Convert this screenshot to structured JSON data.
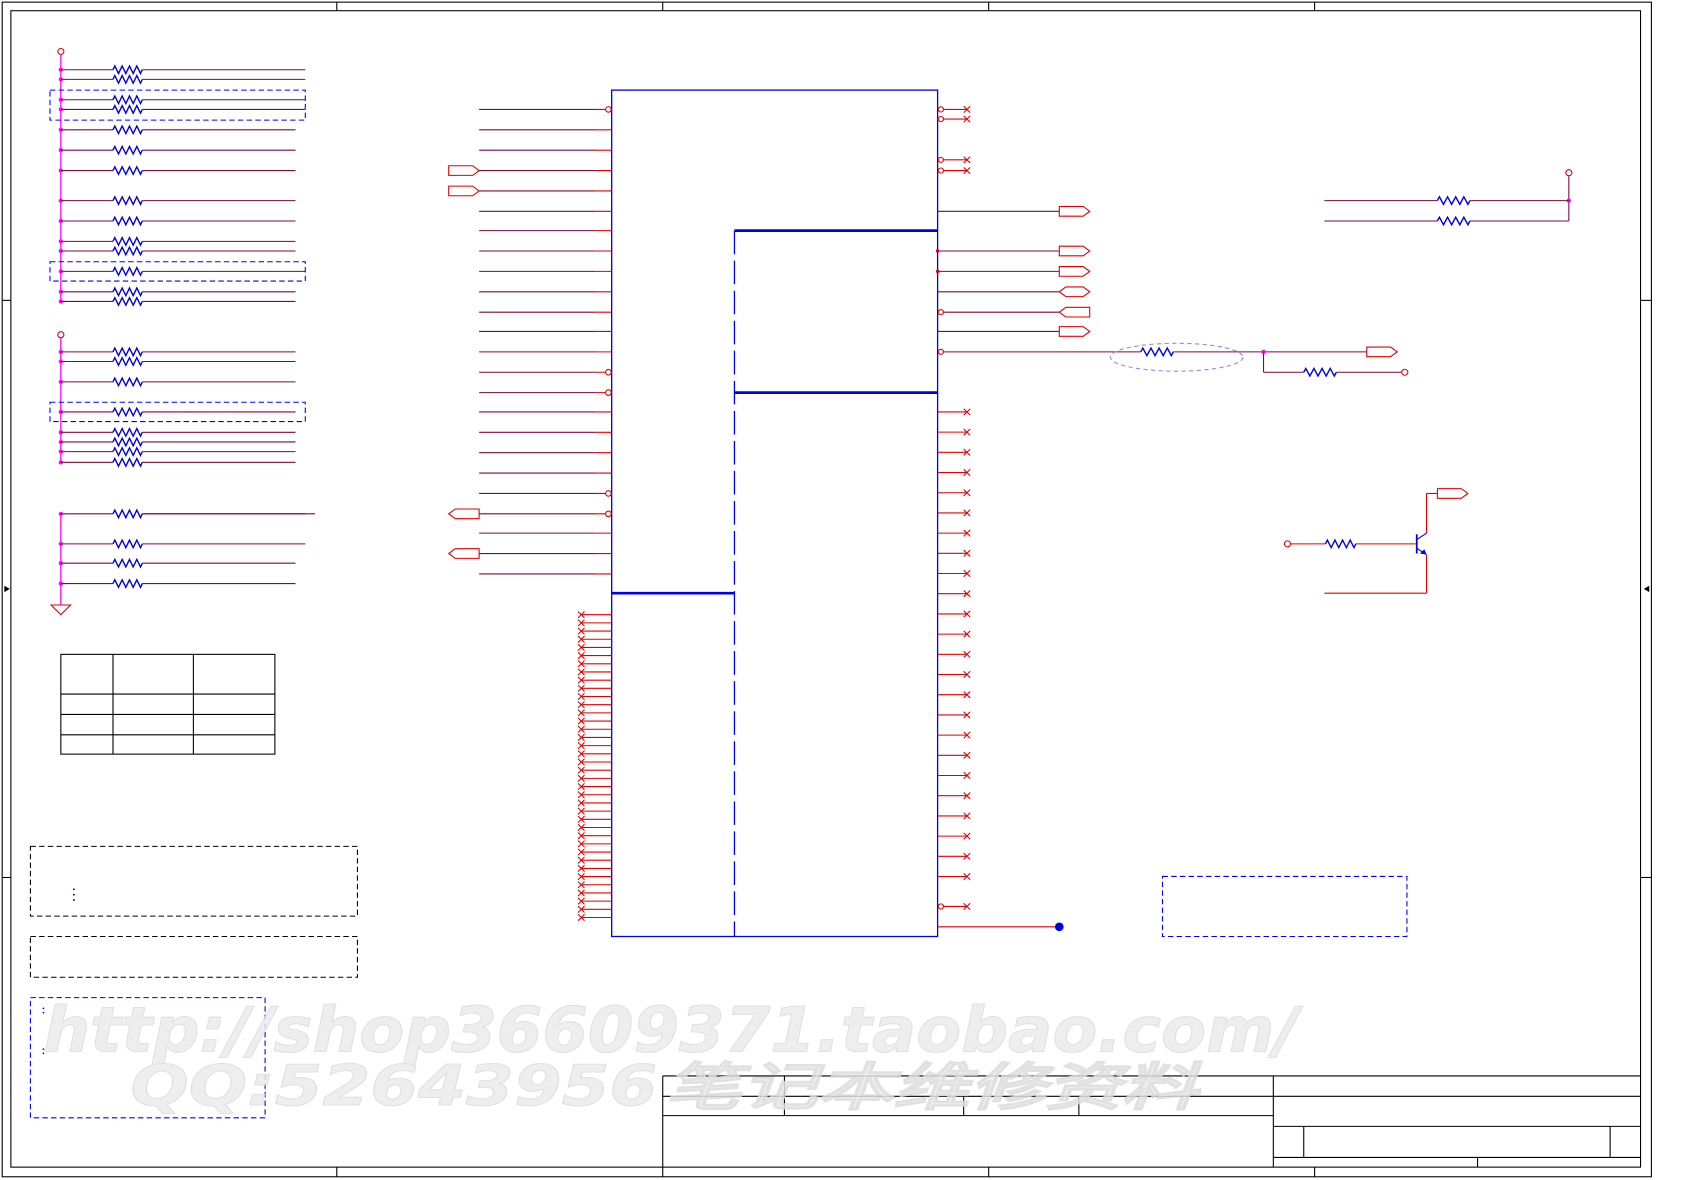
{
  "watermark": {
    "url": "http://shop36609371.taobao.com/",
    "qq": "QQ:52643956",
    "cn": "笔记本维修资料"
  },
  "colors": {
    "frame": "#000000",
    "wire": "#7a0a3c",
    "pin": "#e00000",
    "component": "#0000e0",
    "net_dot": "#ff00ff",
    "dashed_note": "#0000ff",
    "watermark_fill": "#ececec",
    "watermark_stroke": "#dcdcdc"
  }
}
